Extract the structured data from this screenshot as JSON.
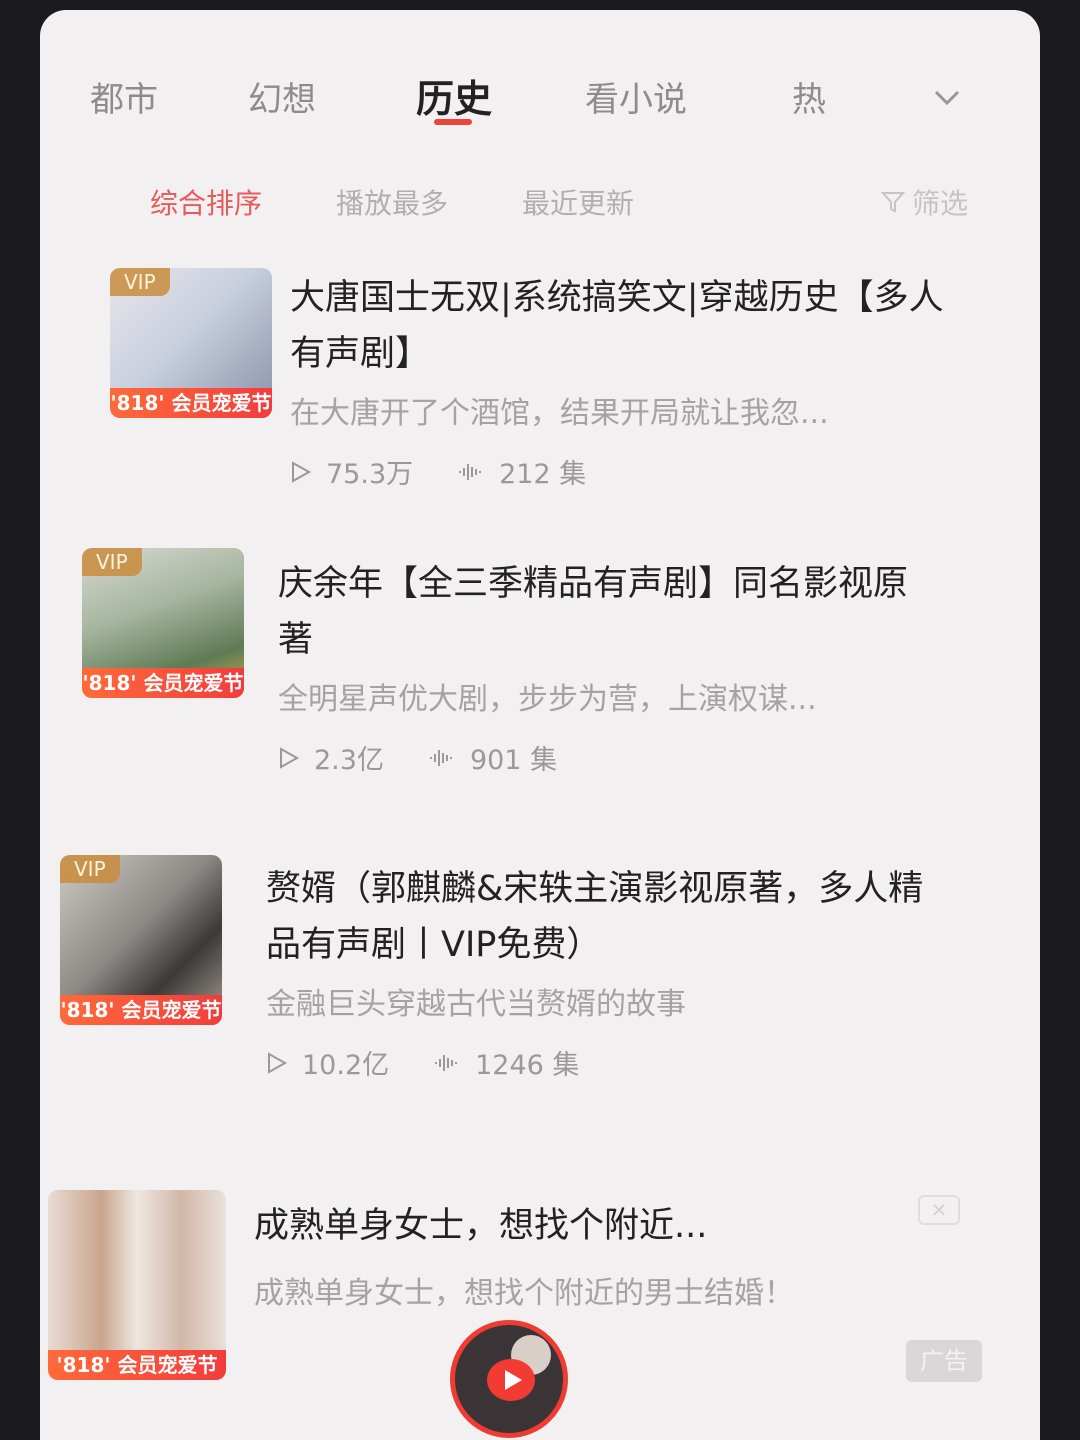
{
  "tabs": [
    {
      "label": "都市"
    },
    {
      "label": "幻想"
    },
    {
      "label": "历史"
    },
    {
      "label": "看小说"
    },
    {
      "label": "热"
    }
  ],
  "sorts": {
    "items": [
      "综合排序",
      "播放最多",
      "最近更新"
    ],
    "filter_label": "筛选"
  },
  "list": [
    {
      "title": "大唐国士无双|系统搞笑文|穿越历史【多人有声剧】",
      "desc": "在大唐开了个酒馆，结果开局就让我忽...",
      "plays": "75.3万",
      "episodes": "212 集",
      "vip": "VIP",
      "promo": "'818' 会员宠爱节"
    },
    {
      "title": "庆余年【全三季精品有声剧】同名影视原著",
      "desc": "全明星声优大剧，步步为营，上演权谋...",
      "plays": "2.3亿",
      "episodes": "901 集",
      "vip": "VIP",
      "promo": "'818' 会员宠爱节"
    },
    {
      "title": "赘婿（郭麒麟&宋轶主演影视原著，多人精品有声剧丨VIP免费）",
      "desc": "金融巨头穿越古代当赘婿的故事",
      "plays": "10.2亿",
      "episodes": "1246 集",
      "vip": "VIP",
      "promo": "'818' 会员宠爱节"
    }
  ],
  "ad": {
    "title": "成熟单身女士，想找个附近...",
    "desc": "成熟单身女士，想找个附近的男士结婚！",
    "label": "广告",
    "promo": "'818' 会员宠爱节"
  },
  "colors": {
    "accent": "#e9453a",
    "promo": "#f23c3c"
  }
}
